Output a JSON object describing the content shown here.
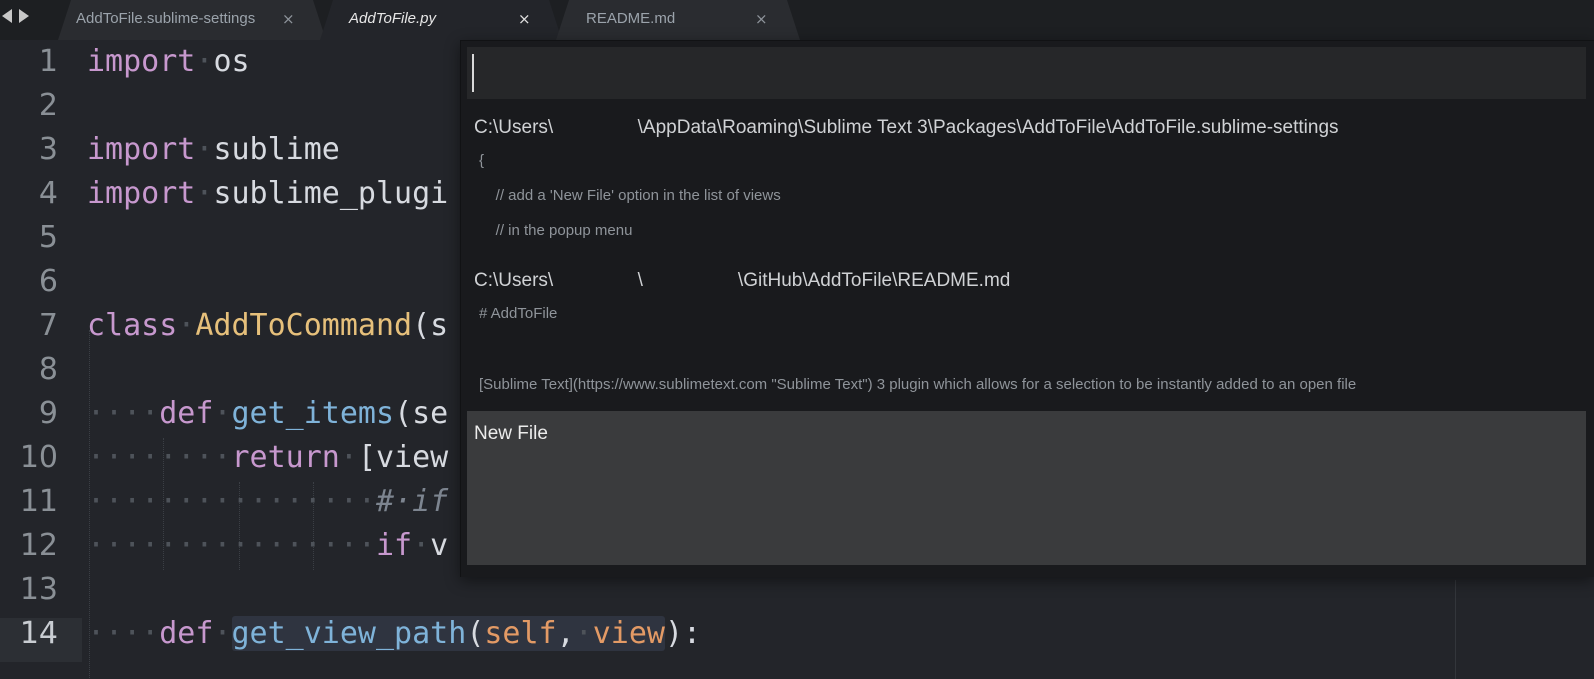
{
  "colors": {
    "editor_background": "#23252a",
    "tab_bar_background": "#1d1f22",
    "popup_background": "#191a1d",
    "selected_item_background": "#3a3b3d",
    "keyword": "#c798ce",
    "class_name": "#e6c07b",
    "function_name": "#7fb3d9",
    "parameter": "#e39a65"
  },
  "navigation": {
    "back_icon": "triangle-left",
    "forward_icon": "triangle-right"
  },
  "tabs": [
    {
      "label": "AddToFile.sublime-settings",
      "close": "×",
      "active": false
    },
    {
      "label": "AddToFile.py",
      "close": "×",
      "active": true
    },
    {
      "label": "README.md",
      "close": "×",
      "active": false
    }
  ],
  "editor": {
    "current_line": 14,
    "line_numbers": [
      "1",
      "2",
      "3",
      "4",
      "5",
      "6",
      "7",
      "8",
      "9",
      "10",
      "11",
      "12",
      "13",
      "14"
    ],
    "code": {
      "line1": {
        "kw": "import",
        "ws": "·",
        "text": "os"
      },
      "line3": {
        "kw": "import",
        "ws": "·",
        "text": "sublime"
      },
      "line4": {
        "kw": "import",
        "ws": "·",
        "text": "sublime_plugi"
      },
      "line7": {
        "kw": "class",
        "ws": "·",
        "cls": "AddToCommand",
        "rest": "(s"
      },
      "line9": {
        "ws": "····",
        "kw": "def",
        "ws2": "·",
        "fn": "get_items",
        "rest": "(se"
      },
      "line10": {
        "ws": "········",
        "kw": "return",
        "ws2": "·",
        "rest": "[view"
      },
      "line11": {
        "ws": "················",
        "cmt": "#·if"
      },
      "line12": {
        "ws": "················",
        "kw": "if",
        "ws2": "·",
        "rest": "v"
      },
      "line14": {
        "ws": "····",
        "kw": "def",
        "ws2": "·",
        "fn": "get_view_path",
        "p1": "(",
        "self": "self",
        "comma": ",",
        "ws3": "·",
        "view": "view",
        "end": "):"
      }
    }
  },
  "quick_panel": {
    "input_value": "",
    "items": [
      {
        "title": "C:\\Users\\                \\AppData\\Roaming\\Sublime Text 3\\Packages\\AddToFile\\AddToFile.sublime-settings",
        "details": [
          "{",
          "    // add a 'New File' option in the list of views",
          "    // in the popup menu"
        ],
        "selected": false
      },
      {
        "title": "C:\\Users\\                \\                  \\GitHub\\AddToFile\\README.md",
        "details": [
          "# AddToFile",
          "",
          "[Sublime Text](https://www.sublimetext.com \"Sublime Text\") 3 plugin which allows for a selection to be instantly added to an open file"
        ],
        "selected": false
      },
      {
        "title": "New File",
        "details": [],
        "selected": true
      }
    ]
  }
}
